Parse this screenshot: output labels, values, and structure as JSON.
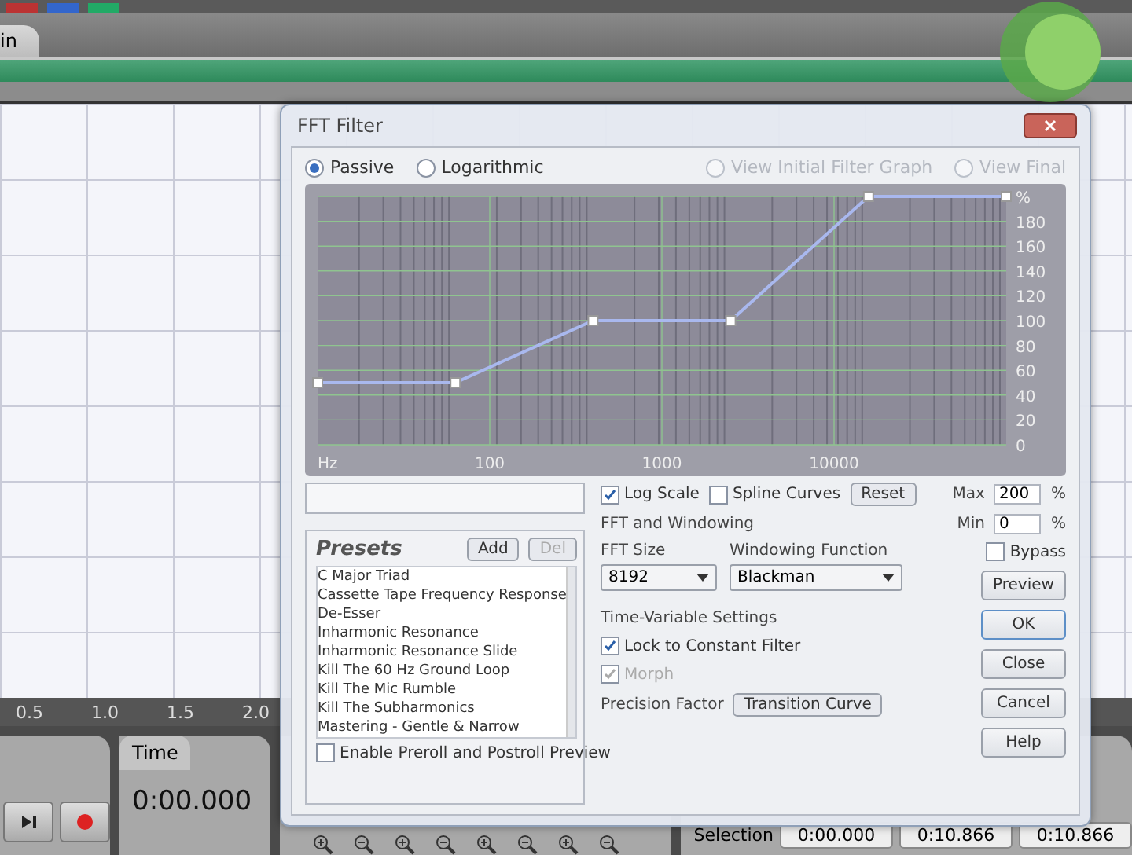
{
  "editor": {
    "tab": "in",
    "ruler": [
      "0.5",
      "1.0",
      "1.5",
      "2.0"
    ],
    "time_panel": {
      "tab": "Time",
      "value": "0:00.000"
    },
    "selection": {
      "label": "Selection",
      "begin": "0:00.000",
      "end": "0:10.866",
      "length": "0:10.866"
    }
  },
  "dialog": {
    "title": "FFT Filter",
    "modes": [
      {
        "label": "Passive",
        "selected": true
      },
      {
        "label": "Logarithmic",
        "selected": false
      }
    ],
    "views": [
      {
        "label": "View Initial Filter Graph",
        "selected": false,
        "disabled": true
      },
      {
        "label": "View Final",
        "selected": false,
        "disabled": true
      }
    ],
    "graph": {
      "x_labels": [
        "100",
        "1000",
        "10000"
      ],
      "chart_data": {
        "type": "line",
        "xlabel": "Hz",
        "grid": true,
        "ylim": [
          0,
          200
        ],
        "yticks": [
          0,
          20,
          40,
          60,
          80,
          100,
          120,
          140,
          160,
          180,
          {
            "value": 200,
            "label": "%"
          }
        ],
        "categories": [
          null,
          null,
          null,
          null,
          null,
          null
        ],
        "series": [
          {
            "color": "#a9b8ee",
            "marker": "square",
            "values": [
              50,
              50,
              100,
              100,
              200,
              200
            ]
          }
        ]
      }
    },
    "log_scale": {
      "label": "Log Scale",
      "checked": true
    },
    "spline_curves": {
      "label": "Spline Curves",
      "checked": false
    },
    "reset": "Reset",
    "max": {
      "label": "Max",
      "value": "200",
      "unit": "%"
    },
    "min": {
      "label": "Min",
      "value": "0",
      "unit": "%"
    },
    "presets": {
      "title": "Presets",
      "add": "Add",
      "del": "Del",
      "del_disabled": true,
      "items": [
        "C Major Triad",
        "Cassette Tape Frequency Response",
        "De-Esser",
        "Inharmonic Resonance",
        "Inharmonic Resonance Slide",
        "Kill The 60 Hz  Ground Loop",
        "Kill The Mic Rumble",
        "Kill The Subharmonics",
        "Mastering - Gentle & Narrow"
      ]
    },
    "preroll": {
      "label": "Enable Preroll and Postroll Preview",
      "checked": false
    },
    "fft": {
      "heading": "FFT and Windowing",
      "size_label": "FFT Size",
      "size": "8192",
      "window_label": "Windowing Function",
      "window": "Blackman"
    },
    "time_variable": {
      "heading": "Time-Variable Settings",
      "lock": {
        "label": "Lock to Constant Filter",
        "checked": true
      },
      "morph": {
        "label": "Morph",
        "checked": true,
        "disabled": true
      },
      "precision_label": "Precision Factor",
      "transition": "Transition Curve"
    },
    "bypass": {
      "label": "Bypass",
      "checked": false
    },
    "buttons": [
      {
        "label": "Preview",
        "default": false
      },
      {
        "label": "OK",
        "default": true
      },
      {
        "label": "Close",
        "default": false
      },
      {
        "label": "Cancel",
        "default": false
      },
      {
        "label": "Help",
        "default": false
      }
    ]
  }
}
